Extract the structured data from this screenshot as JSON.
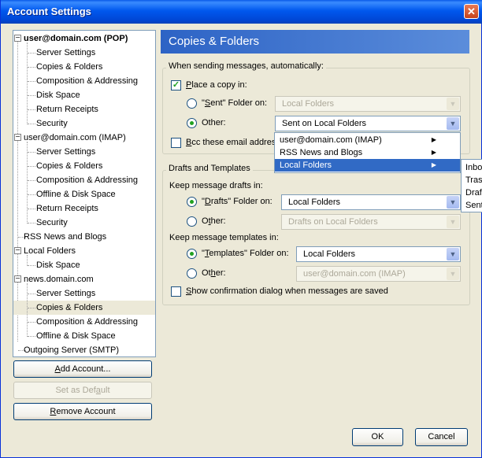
{
  "window": {
    "title": "Account Settings",
    "close_glyph": "✕"
  },
  "tree": [
    {
      "label": "user@domain.com  (POP)",
      "bold": true,
      "level": 0,
      "toggle": "−"
    },
    {
      "label": "Server Settings",
      "level": 1
    },
    {
      "label": "Copies & Folders",
      "level": 1
    },
    {
      "label": "Composition & Addressing",
      "level": 1
    },
    {
      "label": "Disk Space",
      "level": 1
    },
    {
      "label": "Return Receipts",
      "level": 1
    },
    {
      "label": "Security",
      "level": 1
    },
    {
      "label": "user@domain.com  (IMAP)",
      "level": 0,
      "toggle": "−"
    },
    {
      "label": "Server Settings",
      "level": 1
    },
    {
      "label": "Copies & Folders",
      "level": 1
    },
    {
      "label": "Composition & Addressing",
      "level": 1
    },
    {
      "label": "Offline & Disk Space",
      "level": 1
    },
    {
      "label": "Return Receipts",
      "level": 1
    },
    {
      "label": "Security",
      "level": 1
    },
    {
      "label": "RSS News and Blogs",
      "level": 0
    },
    {
      "label": "Local Folders",
      "level": 0,
      "toggle": "−"
    },
    {
      "label": "Disk Space",
      "level": 1
    },
    {
      "label": "news.domain.com",
      "level": 0,
      "toggle": "−"
    },
    {
      "label": "Server Settings",
      "level": 1
    },
    {
      "label": "Copies & Folders",
      "level": 1,
      "selected": true
    },
    {
      "label": "Composition & Addressing",
      "level": 1
    },
    {
      "label": "Offline & Disk Space",
      "level": 1
    },
    {
      "label": "Outgoing Server (SMTP)",
      "level": 0
    }
  ],
  "buttons": {
    "add_account": {
      "pre": "",
      "ul": "A",
      "post": "dd Account..."
    },
    "set_default": {
      "pre": "Set as Def",
      "ul": "a",
      "post": "ult"
    },
    "remove_account": {
      "pre": "",
      "ul": "R",
      "post": "emove Account"
    },
    "ok": "OK",
    "cancel": "Cancel"
  },
  "page": {
    "title": "Copies & Folders"
  },
  "sending": {
    "legend": "When sending messages, automatically:",
    "place_copy": {
      "ul": "P",
      "post": "lace a copy in:",
      "checked": true
    },
    "sent_folder_radio": {
      "pre": "\"",
      "ul": "S",
      "post": "ent\" Folder on:"
    },
    "sent_folder_select": "Local Folders",
    "other_radio": {
      "pre": "Other:"
    },
    "other_select": "Sent on Local Folders",
    "bcc": {
      "ul": "B",
      "post": "cc these email address"
    }
  },
  "folder_menu": {
    "items": [
      {
        "label": "user@domain.com  (IMAP)",
        "arrow": "▶"
      },
      {
        "label": "RSS News and Blogs",
        "arrow": "▶"
      },
      {
        "label": "Local Folders",
        "arrow": "▶",
        "highlighted": true
      }
    ],
    "submenu": [
      "Inbo",
      "Tras",
      "Draf",
      "Sent"
    ]
  },
  "drafts": {
    "legend": "Drafts and Templates",
    "keep_drafts_label": "Keep message drafts in:",
    "drafts_radio": {
      "pre": "\"",
      "ul": "D",
      "post": "rafts\" Folder on:"
    },
    "drafts_select": "Local Folders",
    "drafts_other": {
      "pre": "O",
      "ul": "t",
      "post": "her:"
    },
    "drafts_other_select": "Drafts on Local Folders",
    "keep_templates_label": "Keep message templates in:",
    "templates_radio": {
      "pre": "\"",
      "ul": "T",
      "post": "emplates\" Folder on:"
    },
    "templates_select": "Local Folders",
    "templates_other": {
      "pre": "Ot",
      "ul": "h",
      "post": "er:"
    },
    "templates_other_select": "user@domain.com  (IMAP)",
    "confirm": {
      "pre": "",
      "ul": "S",
      "post": "how confirmation dialog when messages are saved"
    }
  },
  "colors": {
    "selection": "#316ac5",
    "header": "#3a6ec6",
    "check": "#21a121"
  }
}
